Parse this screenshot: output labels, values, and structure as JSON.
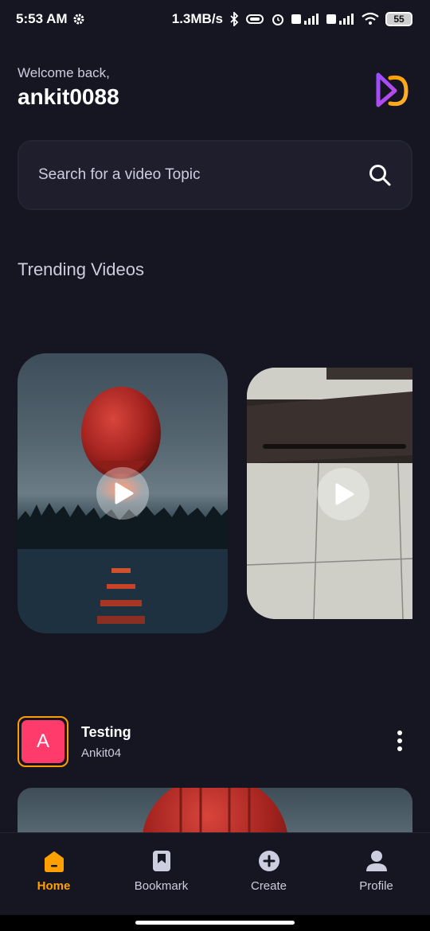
{
  "status_bar": {
    "time": "5:53 AM",
    "speed": "1.3MB/s",
    "battery": "55"
  },
  "header": {
    "welcome": "Welcome back,",
    "username": "ankit0088"
  },
  "search": {
    "placeholder": "Search for a video Topic"
  },
  "trending": {
    "title": "Trending Videos"
  },
  "post": {
    "avatar_letter": "A",
    "title": "Testing",
    "author": "Ankit04"
  },
  "tabs": [
    {
      "label": "Home",
      "icon": "home-icon",
      "active": true
    },
    {
      "label": "Bookmark",
      "icon": "bookmark-icon",
      "active": false
    },
    {
      "label": "Create",
      "icon": "plus-circle-icon",
      "active": false
    },
    {
      "label": "Profile",
      "icon": "profile-icon",
      "active": false
    }
  ],
  "colors": {
    "background": "#161622",
    "accent": "#FFA001",
    "text_muted": "#CDCDE0"
  }
}
